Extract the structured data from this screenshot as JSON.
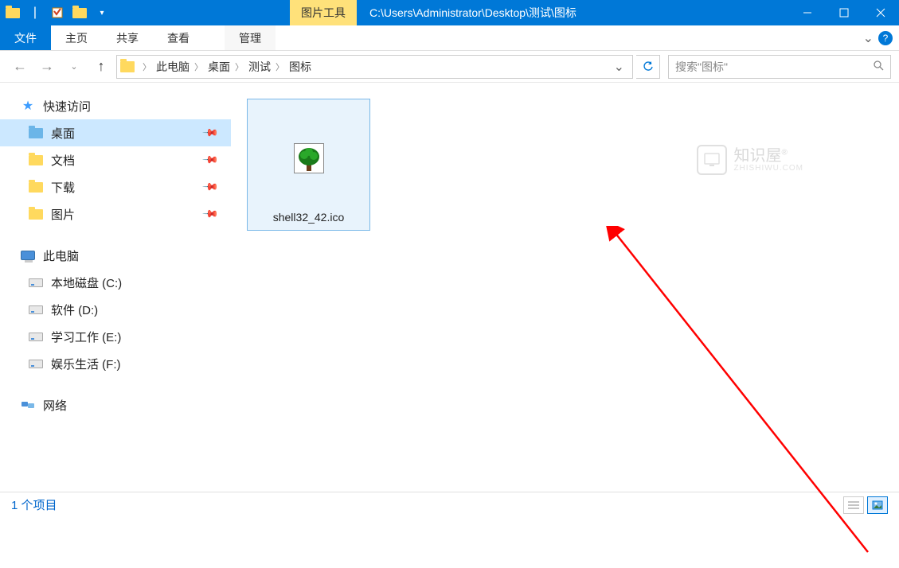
{
  "titlebar": {
    "tool_context": "图片工具",
    "path": "C:\\Users\\Administrator\\Desktop\\测试\\图标"
  },
  "ribbon": {
    "file": "文件",
    "tabs": [
      "主页",
      "共享",
      "查看"
    ],
    "tool_tab": "管理"
  },
  "breadcrumbs": [
    "此电脑",
    "桌面",
    "测试",
    "图标"
  ],
  "search": {
    "placeholder": "搜索\"图标\""
  },
  "sidebar": {
    "quick_access": "快速访问",
    "quick_items": [
      {
        "label": "桌面",
        "selected": true,
        "pinned": true,
        "icon": "folder-blue"
      },
      {
        "label": "文档",
        "selected": false,
        "pinned": true,
        "icon": "folder"
      },
      {
        "label": "下载",
        "selected": false,
        "pinned": true,
        "icon": "folder"
      },
      {
        "label": "图片",
        "selected": false,
        "pinned": true,
        "icon": "folder"
      }
    ],
    "this_pc": "此电脑",
    "drives": [
      {
        "label": "本地磁盘 (C:)"
      },
      {
        "label": "软件 (D:)"
      },
      {
        "label": "学习工作 (E:)"
      },
      {
        "label": "娱乐生活 (F:)"
      }
    ],
    "network": "网络"
  },
  "content": {
    "files": [
      {
        "name": "shell32_42.ico"
      }
    ]
  },
  "watermark": {
    "brand": "知识屋",
    "sub": "ZHISHIWU.COM"
  },
  "statusbar": {
    "count_label": "1 个项目"
  }
}
